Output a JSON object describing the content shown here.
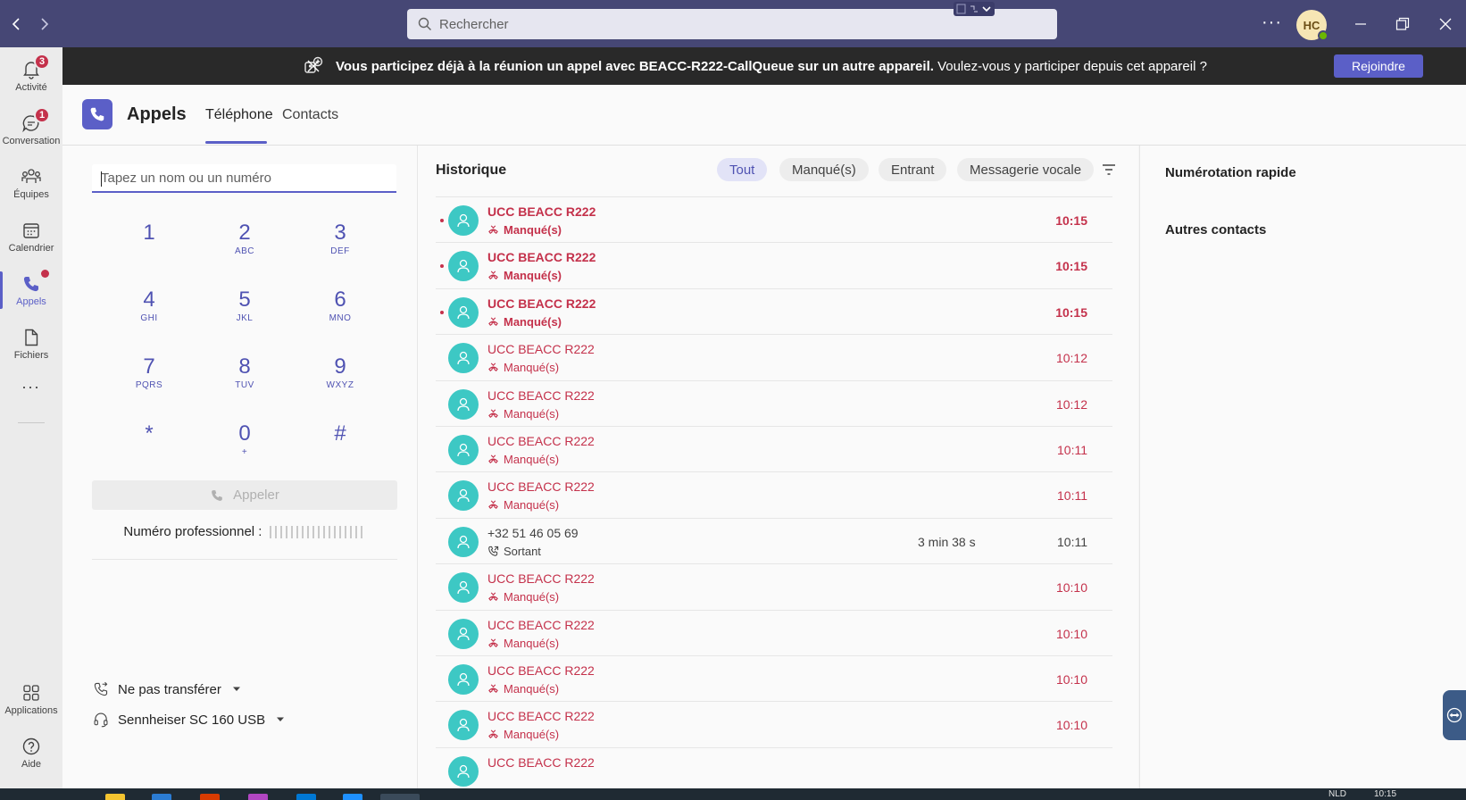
{
  "titlebar": {
    "search_placeholder": "Rechercher",
    "more": "···",
    "avatar_initials": "HC"
  },
  "rail": {
    "items": [
      {
        "label": "Activité",
        "badge": "3"
      },
      {
        "label": "Conversation",
        "badge": "1"
      },
      {
        "label": "Équipes"
      },
      {
        "label": "Calendrier"
      },
      {
        "label": "Appels"
      },
      {
        "label": "Fichiers"
      },
      {
        "label": "Applications"
      },
      {
        "label": "Aide"
      }
    ],
    "more": "···"
  },
  "banner": {
    "bold_text": "Vous participez déjà à la réunion un appel avec BEACC-R222-CallQueue sur un autre appareil.",
    "text": " Voulez-vous y participer depuis cet appareil ?",
    "join_label": "Rejoindre"
  },
  "app": {
    "title": "Appels",
    "tabs": [
      {
        "label": "Téléphone"
      },
      {
        "label": "Contacts"
      }
    ]
  },
  "dialer": {
    "placeholder": "Tapez un nom ou un numéro",
    "keys": [
      {
        "d": "1",
        "s": ""
      },
      {
        "d": "2",
        "s": "ABC"
      },
      {
        "d": "3",
        "s": "DEF"
      },
      {
        "d": "4",
        "s": "GHI"
      },
      {
        "d": "5",
        "s": "JKL"
      },
      {
        "d": "6",
        "s": "MNO"
      },
      {
        "d": "7",
        "s": "PQRS"
      },
      {
        "d": "8",
        "s": "TUV"
      },
      {
        "d": "9",
        "s": "WXYZ"
      },
      {
        "d": "*",
        "s": ""
      },
      {
        "d": "0",
        "s": "+"
      },
      {
        "d": "#",
        "s": ""
      }
    ],
    "call_label": "Appeler",
    "work_number_label": "Numéro professionnel :",
    "forward_label": "Ne pas transférer",
    "device_label": "Sennheiser SC 160 USB"
  },
  "history": {
    "title": "Historique",
    "filters": [
      {
        "label": "Tout",
        "active": true
      },
      {
        "label": "Manqué(s)"
      },
      {
        "label": "Entrant"
      },
      {
        "label": "Messagerie vocale"
      }
    ],
    "rows": [
      {
        "name": "UCC BEACC R222",
        "status": "Manqué(s)",
        "time": "10:15",
        "bold": true,
        "duration": ""
      },
      {
        "name": "UCC BEACC R222",
        "status": "Manqué(s)",
        "time": "10:15",
        "bold": true,
        "duration": ""
      },
      {
        "name": "UCC BEACC R222",
        "status": "Manqué(s)",
        "time": "10:15",
        "bold": true,
        "duration": ""
      },
      {
        "name": "UCC BEACC R222",
        "status": "Manqué(s)",
        "time": "10:12",
        "bold": false,
        "duration": ""
      },
      {
        "name": "UCC BEACC R222",
        "status": "Manqué(s)",
        "time": "10:12",
        "bold": false,
        "duration": ""
      },
      {
        "name": "UCC BEACC R222",
        "status": "Manqué(s)",
        "time": "10:11",
        "bold": false,
        "duration": ""
      },
      {
        "name": "UCC BEACC R222",
        "status": "Manqué(s)",
        "time": "10:11",
        "bold": false,
        "duration": ""
      },
      {
        "name": "+32 51 46 05 69",
        "status": "Sortant",
        "time": "10:11",
        "bold": false,
        "duration": "3 min 38 s",
        "outgoing": true
      },
      {
        "name": "UCC BEACC R222",
        "status": "Manqué(s)",
        "time": "10:10",
        "bold": false,
        "duration": ""
      },
      {
        "name": "UCC BEACC R222",
        "status": "Manqué(s)",
        "time": "10:10",
        "bold": false,
        "duration": ""
      },
      {
        "name": "UCC BEACC R222",
        "status": "Manqué(s)",
        "time": "10:10",
        "bold": false,
        "duration": ""
      },
      {
        "name": "UCC BEACC R222",
        "status": "Manqué(s)",
        "time": "10:10",
        "bold": false,
        "duration": ""
      },
      {
        "name": "UCC BEACC R222",
        "status": "",
        "time": "",
        "bold": false,
        "duration": ""
      }
    ]
  },
  "right_panel": {
    "speed_dial": "Numérotation rapide",
    "other_contacts": "Autres contacts"
  },
  "taskbar": {
    "lang": "NLD",
    "time": "10:15"
  },
  "colors": {
    "titlebar": "#464775",
    "accent": "#5b5fc7",
    "missed": "#c4314b",
    "avatar": "#3dc8c4",
    "banner": "#292929"
  }
}
